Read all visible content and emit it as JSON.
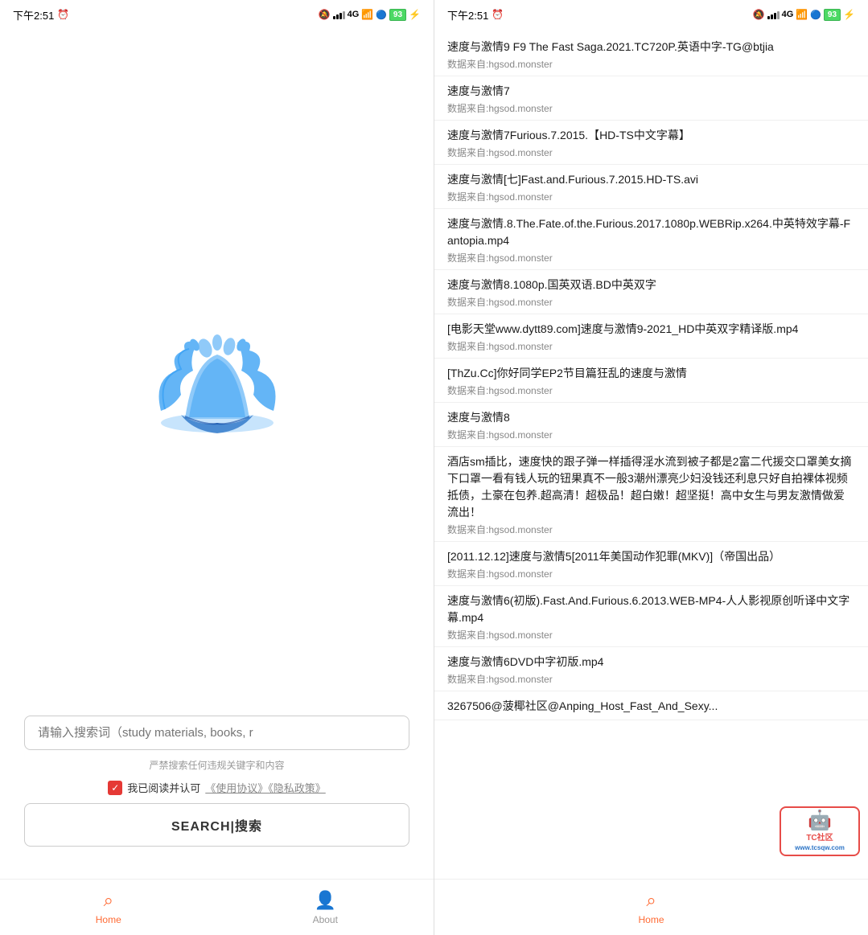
{
  "left_phone": {
    "status_bar": {
      "time": "下午2:51",
      "signal": "信号",
      "battery": "93"
    },
    "search": {
      "placeholder": "请输入搜索词（study materials, books, r",
      "warning": "严禁搜索任何违规关键字和内容",
      "agree_label": "我已阅读并认可",
      "agree_link": "《使用协议》《隐私政策》",
      "button_label": "SEARCH|搜索"
    },
    "nav": {
      "home_label": "Home",
      "about_label": "About"
    }
  },
  "right_phone": {
    "status_bar": {
      "time": "下午2:51",
      "battery": "93"
    },
    "results": [
      {
        "title": "速度与激情9 F9 The Fast Saga.2021.TC720P.英语中字-TG@btjia",
        "source": "数据来自:hgsod.monster"
      },
      {
        "title": "速度与激情7",
        "source": "数据来自:hgsod.monster"
      },
      {
        "title": "速度与激情7Furious.7.2015.【HD-TS中文字幕】",
        "source": "数据来自:hgsod.monster"
      },
      {
        "title": "速度与激情[七]Fast.and.Furious.7.2015.HD-TS.avi",
        "source": "数据来自:hgsod.monster"
      },
      {
        "title": "速度与激情.8.The.Fate.of.the.Furious.2017.1080p.WEBRip.x264.中英特效字幕-Fantopia.mp4",
        "source": "数据来自:hgsod.monster"
      },
      {
        "title": "速度与激情8.1080p.国英双语.BD中英双字",
        "source": "数据来自:hgsod.monster"
      },
      {
        "title": "[电影天堂www.dytt89.com]速度与激情9-2021_HD中英双字精译版.mp4",
        "source": "数据来自:hgsod.monster"
      },
      {
        "title": "[ThZu.Cc]你好同学EP2节目篇狂乱的速度与激情",
        "source": "数据来自:hgsod.monster"
      },
      {
        "title": "速度与激情8",
        "source": "数据来自:hgsod.monster"
      },
      {
        "title": "酒店sm插比，速度快的跟子弹一样插得淫水流到被子都是2富二代援交口罩美女摘下口罩一看有钱人玩的钮果真不一般3潮州漂亮少妇没钱还利息只好自拍裸体视频抵债，土豪在包养.超高清！超极品！超白嫩！超坚挺！高中女生与男友激情做爱流出！",
        "source": "数据来自:hgsod.monster"
      },
      {
        "title": "[2011.12.12]速度与激情5[2011年美国动作犯罪(MKV)]（帝国出品）",
        "source": "数据来自:hgsod.monster"
      },
      {
        "title": "速度与激情6(初版).Fast.And.Furious.6.2013.WEB-MP4-人人影视原创听译中文字幕.mp4",
        "source": "数据来自:hgsod.monster"
      },
      {
        "title": "速度与激情6DVD中字初版.mp4",
        "source": "数据来自:hgsod.monster"
      },
      {
        "title": "3267506@菠椰社区@Anping_Host_Fast_And_Sexy...",
        "source": ""
      }
    ],
    "nav": {
      "home_label": "Home"
    }
  },
  "watermark": {
    "site": "TC社区",
    "url": "www.tcsqw.com"
  }
}
